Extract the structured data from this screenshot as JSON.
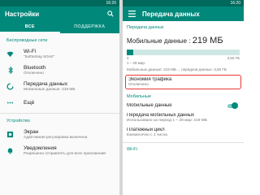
{
  "left": {
    "title": "Настройки",
    "tabs": [
      "ВСЕ",
      "ПОДДЕРЖКА"
    ],
    "section_wireless": "Беспроводные сети",
    "section_device": "Устройство",
    "items": [
      {
        "icon": "wifi-icon",
        "label": "Wi-Fi",
        "sub": "\"buffterbay 5GHz\""
      },
      {
        "icon": "bluetooth-icon",
        "label": "Bluetooth",
        "sub": "Отключено"
      },
      {
        "icon": "data-usage-icon",
        "label": "Передача данных",
        "sub": "Мобильные данные: 219 МБ"
      },
      {
        "icon": "more-icon",
        "label": "Ещё",
        "sub": ""
      },
      {
        "icon": "display-icon",
        "label": "Экран",
        "sub": "Адаптивная регулировка включена"
      },
      {
        "icon": "notifications-icon",
        "label": "Уведомления",
        "sub": "Разрешено отправлять для всех приложений"
      }
    ]
  },
  "right": {
    "title": "Передача данных",
    "section_mobile_data": "Передача данных",
    "big_label": "Мобильные данные : ",
    "big_value": "219 МБ",
    "usage_fraction": 0.06,
    "bar_left": "0",
    "bar_right": "3,50 ГБ",
    "date_range": "1 – 29 мар.",
    "usage_text": "Мобильные данные: 219 МБ ... передачи данных: 3,50 ГБ",
    "economy": {
      "label": "Экономия трафика",
      "sub": "Отключено"
    },
    "section_mobile": "Мобильные",
    "mobile_data_label": "Мобильные данные",
    "mobile_data_on": true,
    "transfer": {
      "label": "Передача мобильных данных",
      "sub": "Использовано за период 1 – 29 мар: 219 МБ"
    },
    "billing": {
      "label": "Платежный цикл",
      "sub": "Ежемесячно с 1 числа"
    },
    "section_wifi": "Wi-Fi"
  },
  "status_time": "16:20",
  "colors": {
    "primary": "#00897b",
    "primary_dark": "#00695c",
    "highlight": "#e53935"
  }
}
